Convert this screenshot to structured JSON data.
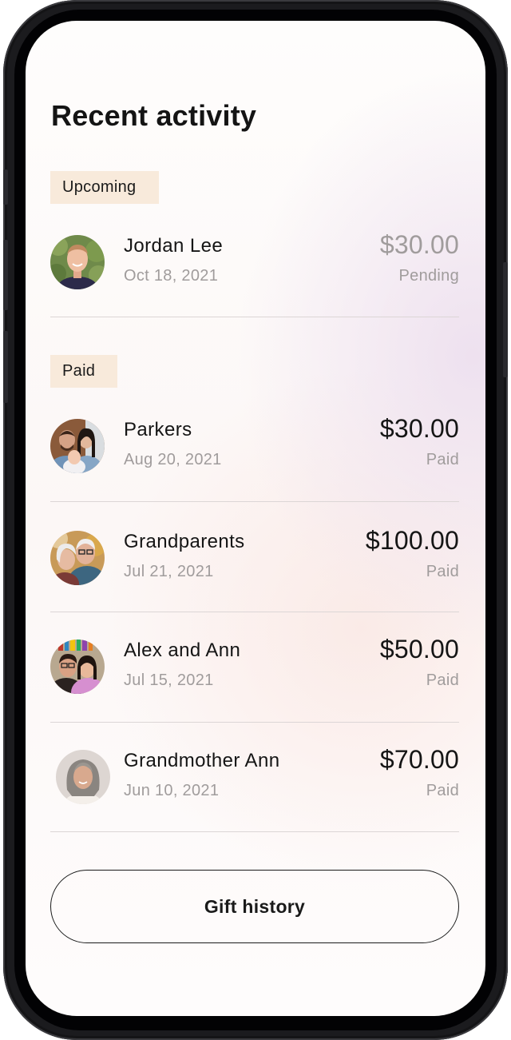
{
  "page": {
    "title": "Recent activity"
  },
  "sections": {
    "upcoming": {
      "label": "Upcoming",
      "items": [
        {
          "name": "Jordan Lee",
          "date": "Oct 18, 2021",
          "amount": "$30.00",
          "status": "Pending",
          "avatar": "person-photo-jordan"
        }
      ]
    },
    "paid": {
      "label": "Paid",
      "items": [
        {
          "name": "Parkers",
          "date": "Aug 20, 2021",
          "amount": "$30.00",
          "status": "Paid",
          "avatar": "family-photo-parkers"
        },
        {
          "name": "Grandparents",
          "date": "Jul 21, 2021",
          "amount": "$100.00",
          "status": "Paid",
          "avatar": "couple-photo-grandparents"
        },
        {
          "name": "Alex and Ann",
          "date": "Jul 15, 2021",
          "amount": "$50.00",
          "status": "Paid",
          "avatar": "couple-photo-alex-ann"
        },
        {
          "name": "Grandmother Ann",
          "date": "Jun 10, 2021",
          "amount": "$70.00",
          "status": "Paid",
          "avatar": "person-photo-grandmother-ann"
        }
      ]
    }
  },
  "footer": {
    "gift_history_label": "Gift history"
  },
  "colors": {
    "tag_background": "#f8eadb",
    "text_primary": "#151515",
    "text_secondary": "#a09c9c"
  }
}
